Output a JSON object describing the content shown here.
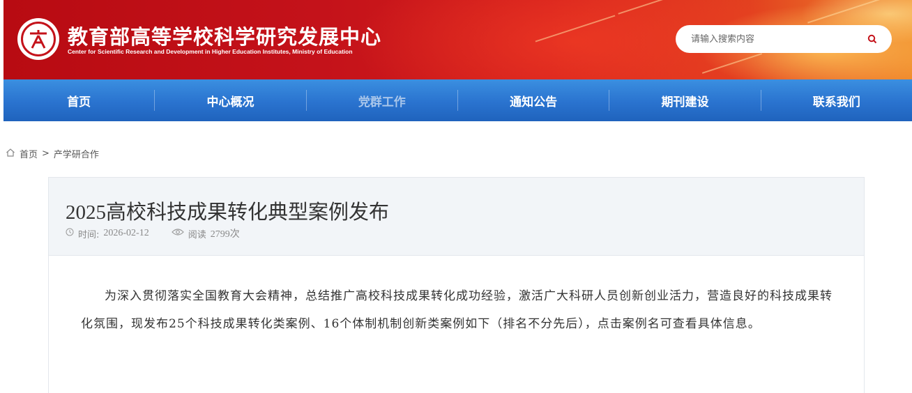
{
  "header": {
    "title": "教育部高等学校科学研究发展中心",
    "subtitle": "Center for Scientific Research and Development in Higher Education Institutes, Ministry of Education",
    "search_placeholder": "请输入搜索内容",
    "search_icon": "search-icon",
    "colors": {
      "primary_red": "#c4121a",
      "nav_blue": "#2a73cf"
    }
  },
  "nav": {
    "items": [
      {
        "label": "首页"
      },
      {
        "label": "中心概况"
      },
      {
        "label": "党群工作"
      },
      {
        "label": "通知公告"
      },
      {
        "label": "期刊建设"
      },
      {
        "label": "联系我们"
      }
    ],
    "active_label": "党群工作"
  },
  "breadcrumb": {
    "home": "首页",
    "separator": ">",
    "current": "产学研合作"
  },
  "article": {
    "title": "2025高校科技成果转化典型案例发布",
    "time_label": "时间:",
    "time_value": "2026-02-12",
    "views_label": "阅读",
    "views_value": "2799次",
    "body": "为深入贯彻落实全国教育大会精神，总结推广高校科技成果转化成功经验，激活广大科研人员创新创业活力，营造良好的科技成果转化氛围，现发布25个科技成果转化类案例、16个体制机制创新类案例如下（排名不分先后），点击案例名可查看具体信息。"
  }
}
